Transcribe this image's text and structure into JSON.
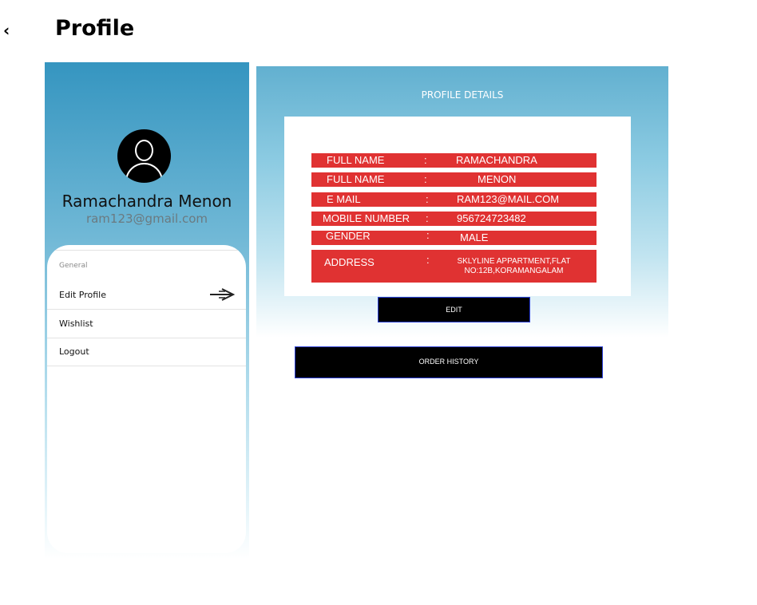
{
  "header": {
    "back_icon": "chevron-left-icon",
    "title": "Profile"
  },
  "profile": {
    "avatar_icon": "user-avatar-icon",
    "name": "Ramachandra Menon",
    "email": "ram123@gmail.com"
  },
  "menu": {
    "section_label": "General",
    "items": [
      {
        "label": "Edit Profile",
        "icon": "arrow-right-icon"
      },
      {
        "label": "Wishlist"
      },
      {
        "label": "Logout"
      }
    ]
  },
  "details": {
    "title": "PROFILE DETAILS",
    "rows": [
      {
        "label": "FULL NAME",
        "colon": ":",
        "value": "RAMACHANDRA"
      },
      {
        "label": "FULL NAME",
        "colon": ":",
        "value": "MENON"
      },
      {
        "label": "E MAIL",
        "colon": ":",
        "value": "RAM123@MAIL.COM"
      },
      {
        "label": "MOBILE NUMBER",
        "colon": ":",
        "value": "956724723482"
      },
      {
        "label": "GENDER",
        "colon": ":",
        "value": "MALE"
      },
      {
        "label": "ADDRESS",
        "colon": ":",
        "value": "SKLYLINE APPARTMENT,FLAT",
        "value_line2": "NO:12B,KORAMANGALAM"
      }
    ],
    "edit_label": "EDIT"
  },
  "order_history_label": "ORDER HISTORY",
  "colors": {
    "row_red": "#e03232",
    "gradient_blue": "#3595c0",
    "button_black": "#000000",
    "button_border": "#2b3fd6"
  }
}
